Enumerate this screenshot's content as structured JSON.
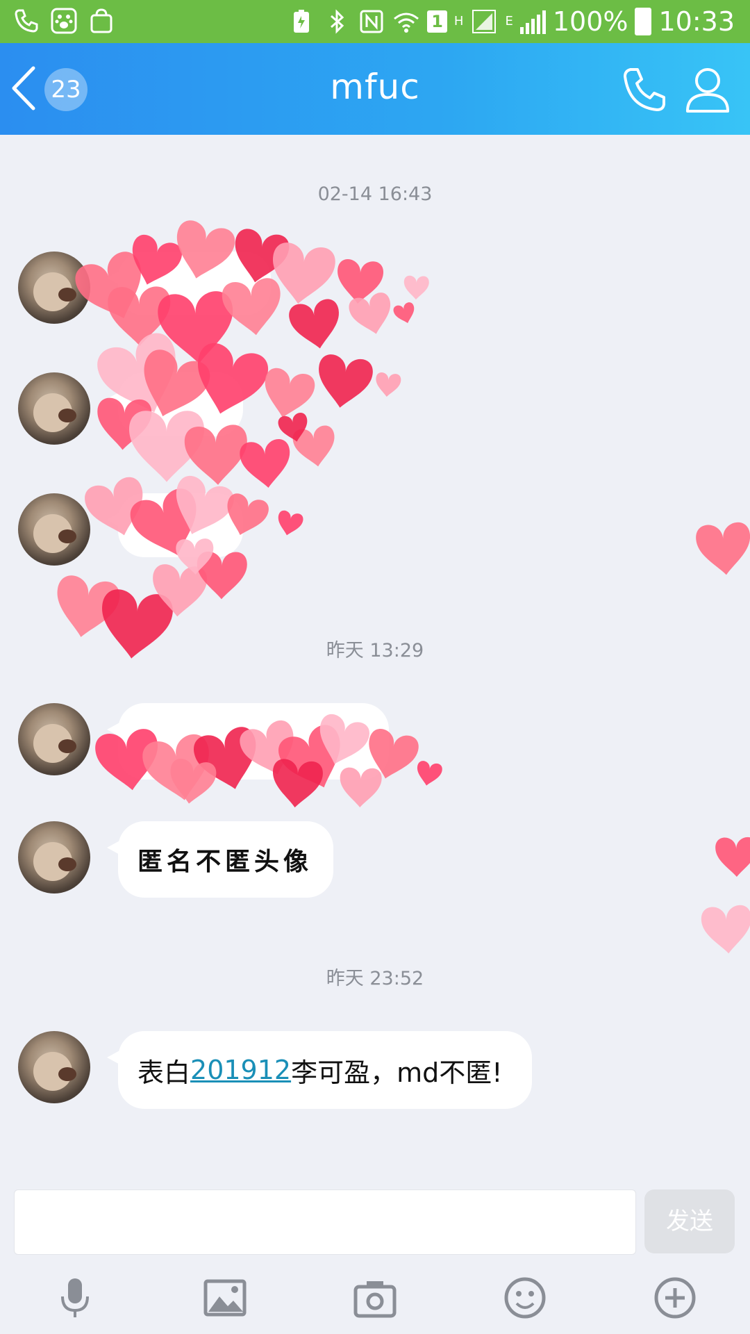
{
  "status_bar": {
    "battery": "100%",
    "time": "10:33",
    "network_h": "H",
    "network_e": "E",
    "sim_slot": "1"
  },
  "header": {
    "unread_count": "23",
    "title": "mfuc"
  },
  "timestamps": [
    "02-14 16:43",
    "昨天 13:29",
    "昨天 23:52"
  ],
  "messages": [
    {
      "text": "匿名不匿头像"
    },
    {
      "prefix": "表白",
      "link": "201912",
      "suffix": "李可盈，md不匿!"
    }
  ],
  "input": {
    "value": "",
    "send_label": "发送"
  },
  "colors": {
    "status_bar": "#6cbd45",
    "header_start": "#2b8ef0",
    "header_end": "#38c4f6",
    "chat_bg": "#eef0f6",
    "link": "#1a8fb7"
  },
  "icons": [
    "phone-icon",
    "paw-icon",
    "bag-icon",
    "battery-saver-icon",
    "bluetooth-icon",
    "nfc-icon",
    "wifi-icon",
    "signal-icon",
    "back-chevron-icon",
    "call-icon",
    "profile-icon",
    "microphone-icon",
    "image-icon",
    "camera-icon",
    "emoji-icon",
    "plus-icon"
  ]
}
